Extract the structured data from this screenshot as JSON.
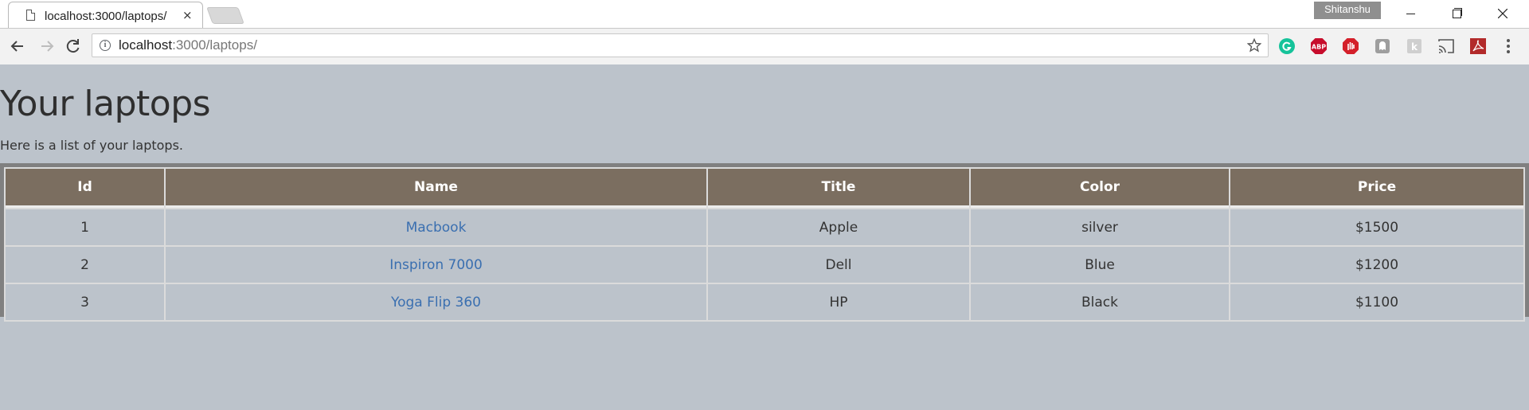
{
  "browser": {
    "tab_title": "localhost:3000/laptops/",
    "tab_close": "×",
    "profile_name": "Shitanshu",
    "url_host": "localhost",
    "url_path": ":3000/laptops/",
    "extensions": [
      "grammarly-icon",
      "adblock-plus-icon",
      "block-hand-icon",
      "ghostery-icon",
      "k-extension-icon",
      "cast-icon",
      "pdf-icon"
    ]
  },
  "page": {
    "title": "Your laptops",
    "description": "Here is a list of your laptops.",
    "colors": {
      "background": "#bcc3cb",
      "header_bg": "#7b6e60",
      "link": "#3a6fb0",
      "table_frame": "#808080"
    }
  },
  "table": {
    "headers": [
      "Id",
      "Name",
      "Title",
      "Color",
      "Price"
    ],
    "rows": [
      {
        "id": "1",
        "name": "Macbook",
        "title": "Apple",
        "color": "silver",
        "price": "$1500"
      },
      {
        "id": "2",
        "name": "Inspiron 7000",
        "title": "Dell",
        "color": "Blue",
        "price": "$1200"
      },
      {
        "id": "3",
        "name": "Yoga Flip 360",
        "title": "HP",
        "color": "Black",
        "price": "$1100"
      }
    ]
  }
}
